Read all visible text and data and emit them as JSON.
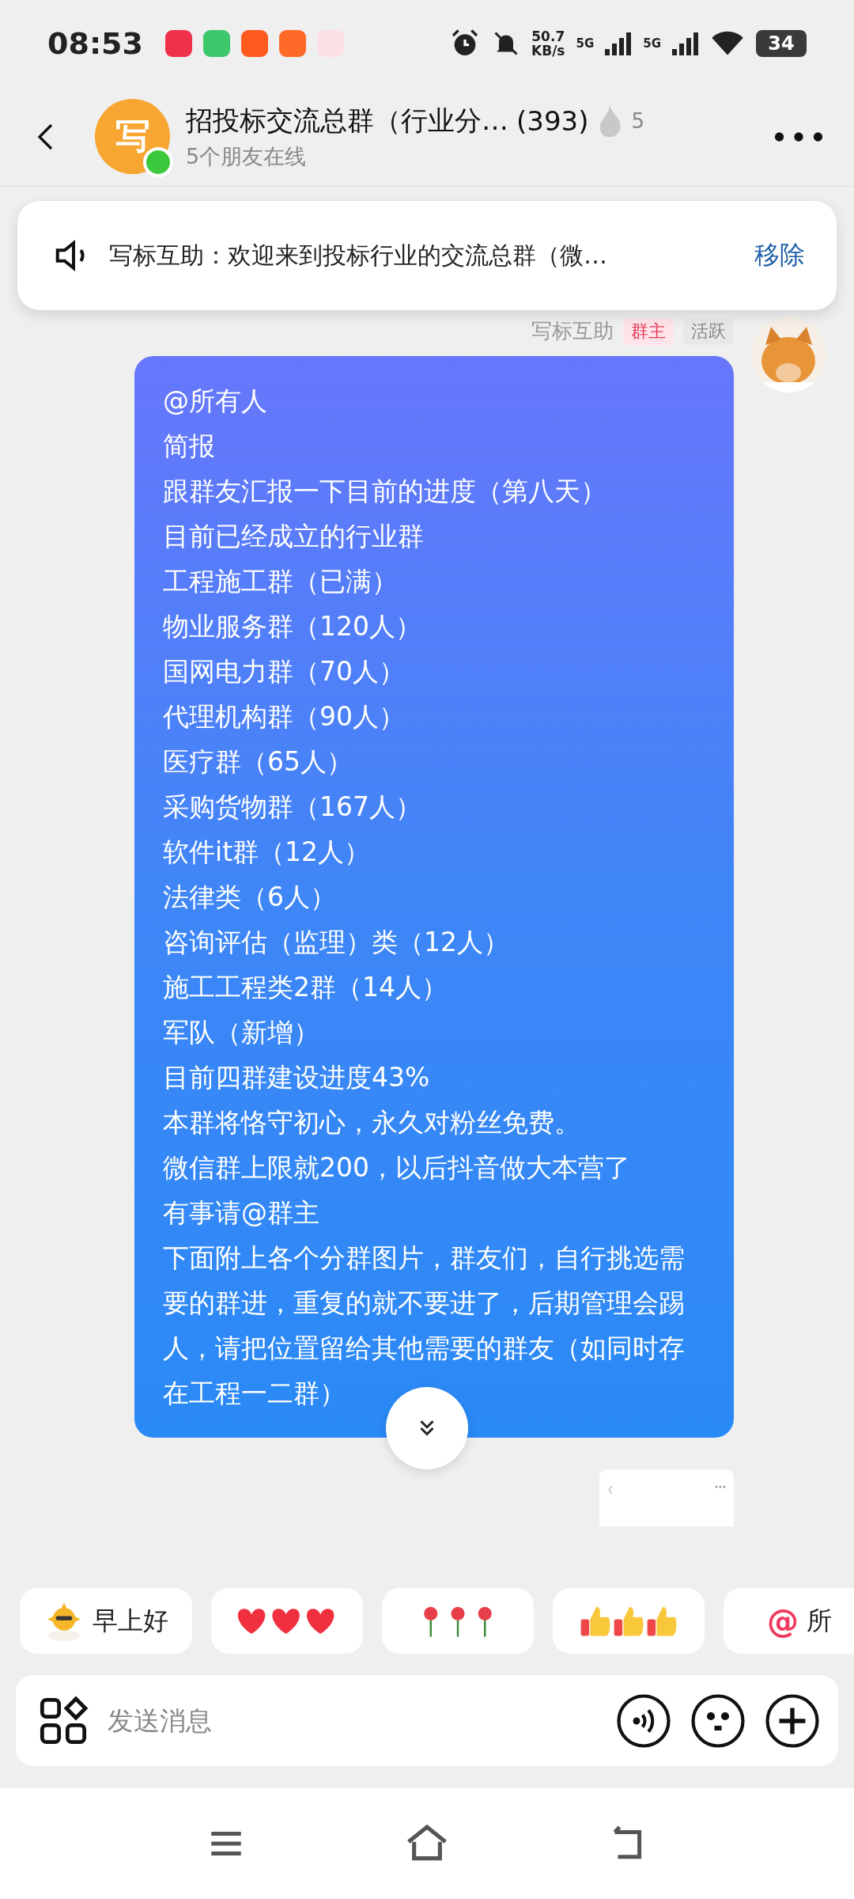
{
  "status_bar": {
    "time": "08:53",
    "speed_value": "50.7",
    "speed_unit": "KB/s",
    "networks": [
      "5G",
      "5G"
    ],
    "battery": "34"
  },
  "header": {
    "avatar_letter": "写",
    "online": true,
    "title": "招投标交流总群（行业分…",
    "member_count": "(393)",
    "heat": "5",
    "subtitle": "5个朋友在线"
  },
  "notice": {
    "text": "写标互助：欢迎来到投标行业的交流总群（微…",
    "action": "移除"
  },
  "message": {
    "sender": "写标互助",
    "badges": [
      {
        "label": "群主",
        "kind": "owner"
      },
      {
        "label": "活跃",
        "kind": "active"
      }
    ],
    "lines": [
      "@所有人",
      "简报",
      "跟群友汇报一下目前的进度（第八天）",
      "目前已经成立的行业群",
      "工程施工群（已满）",
      "物业服务群（120人）",
      "国网电力群（70人）",
      "代理机构群（90人）",
      "医疗群（65人）",
      "采购货物群（167人）",
      "软件it群（12人）",
      "法律类（6人）",
      "咨询评估（监理）类（12人）",
      "施工工程类2群（14人）",
      "军队（新增）",
      "目前四群建设进度43%",
      "本群将恪守初心，永久对粉丝免费。",
      "微信群上限就200，以后抖音做大本营了",
      "有事请@群主",
      "下面附上各个分群图片，群友们，自行挑选需要的群进，重复的就不要进了，后期管理会踢人，请把位置留给其他需要的群友（如同时存在工程一二群）"
    ]
  },
  "quick_replies": [
    {
      "kind": "sun",
      "label": "早上好"
    },
    {
      "kind": "hearts"
    },
    {
      "kind": "roses"
    },
    {
      "kind": "thumbs"
    },
    {
      "kind": "at",
      "symbol": "@",
      "label": "所"
    }
  ],
  "composer": {
    "placeholder": "发送消息"
  }
}
